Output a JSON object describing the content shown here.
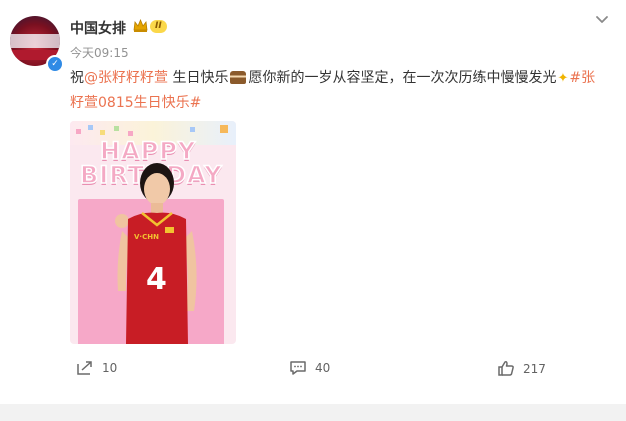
{
  "post": {
    "author": "中国女排",
    "vip_level": "II",
    "time": "今天09:15",
    "content": {
      "prefix": "祝",
      "mention": "@张籽籽籽萱",
      "middle": " 生日快乐",
      "after_cake": "愿你新的一岁从容坚定，在一次次历练中慢慢发光",
      "hashtag_line1": "#张",
      "hashtag_line2": "籽萱0815生日快乐#"
    },
    "image": {
      "line1": "HAPPY",
      "line2": "BIRTHDAY",
      "jersey_number": "4"
    }
  },
  "actions": {
    "repost_count": "10",
    "comment_count": "40",
    "like_count": "217"
  },
  "icons": [
    "crown-icon",
    "vip-badge",
    "chevron-down-icon",
    "repost-icon",
    "comment-icon",
    "like-icon",
    "verified-icon",
    "cake-emoji",
    "sparkle-emoji"
  ],
  "colors": {
    "link": "#eb7350",
    "text": "#333333",
    "muted": "#939393",
    "verified": "#2f8ae5"
  }
}
